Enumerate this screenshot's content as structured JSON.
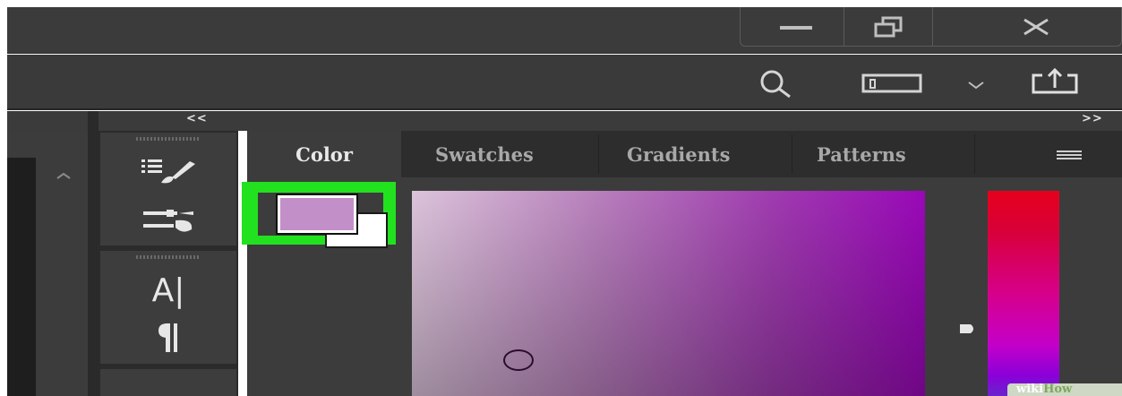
{
  "window": {
    "controls": [
      "minimize-icon",
      "restore-icon",
      "close-icon"
    ]
  },
  "toolbar": {
    "icons": [
      "search-icon",
      "workspace-icon",
      "chevron-down-icon",
      "share-icon"
    ]
  },
  "panel_dock": {
    "collapse_left": "<<",
    "collapse_right": ">>"
  },
  "side_icons": [
    "brush-presets-icon",
    "brush-settings-icon",
    "character-icon",
    "paragraph-icon"
  ],
  "side_labels": {
    "type_glyph": "A|",
    "paragraph_glyph": "¶"
  },
  "color_panel": {
    "tabs": [
      {
        "label": "Color",
        "active": true
      },
      {
        "label": "Swatches",
        "active": false
      },
      {
        "label": "Gradients",
        "active": false
      },
      {
        "label": "Patterns",
        "active": false
      }
    ],
    "foreground_color": "#c38fc8",
    "background_color": "#ffffff",
    "hue_color": "#9a08b8",
    "highlight_color": "#22e11f"
  },
  "watermark": {
    "text_a": "wiki",
    "text_b": "How"
  }
}
